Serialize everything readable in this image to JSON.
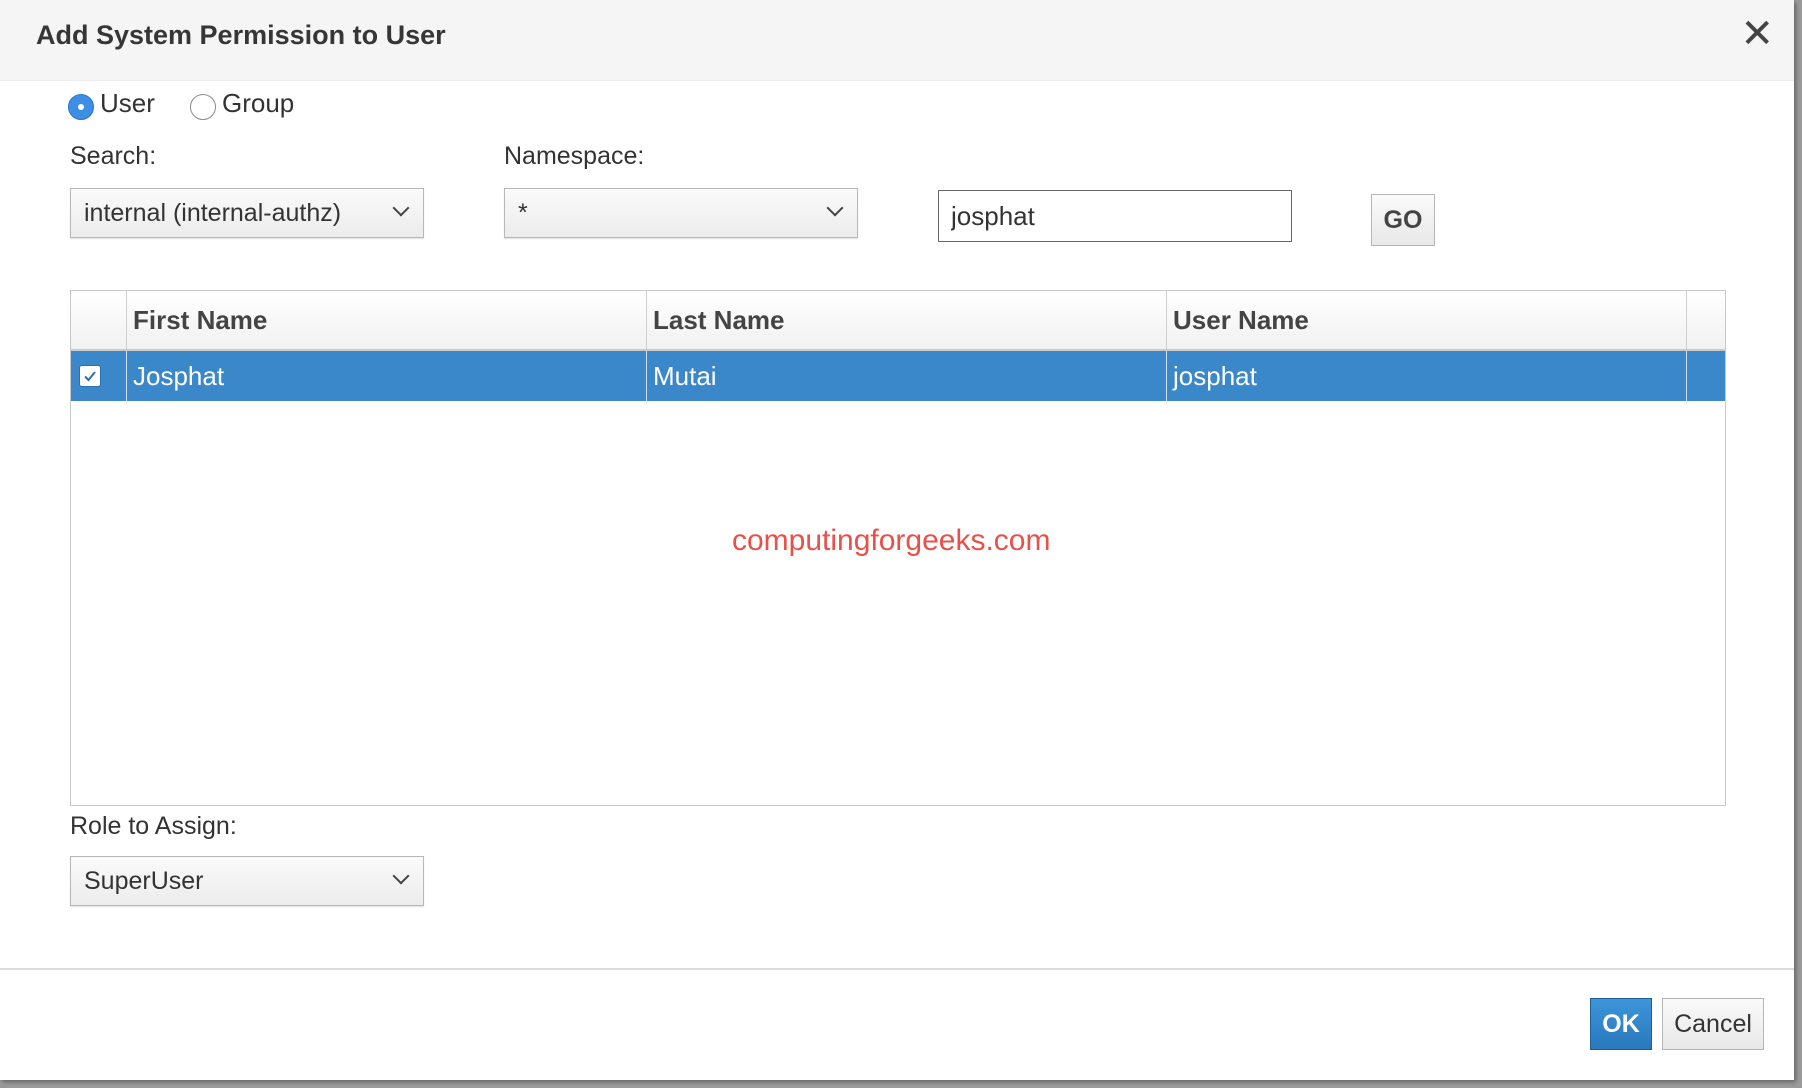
{
  "dialog": {
    "title": "Add System Permission to User",
    "close_glyph": "✕"
  },
  "principal_type": {
    "options": [
      "User",
      "Group"
    ],
    "selected": "User"
  },
  "search": {
    "label": "Search:",
    "value": "internal (internal-authz)"
  },
  "namespace": {
    "label": "Namespace:",
    "value": "*"
  },
  "query": {
    "value": "josphat"
  },
  "go_button": {
    "label": "GO"
  },
  "results_table": {
    "columns": [
      "First Name",
      "Last Name",
      "User Name"
    ],
    "rows": [
      {
        "checked": true,
        "cells": [
          "Josphat",
          "Mutai",
          "josphat"
        ]
      }
    ],
    "selection_color": "#3a87c9"
  },
  "watermark": "computingforgeeks.com",
  "role": {
    "label": "Role to Assign:",
    "value": "SuperUser"
  },
  "footer": {
    "ok_label": "OK",
    "cancel_label": "Cancel"
  },
  "colors": {
    "primary": "#2a78bd",
    "radio_selected": "#3f8ee6",
    "watermark": "#e8514a"
  },
  "icons": [
    "close-icon",
    "chevron-down-icon",
    "checkmark-icon"
  ]
}
